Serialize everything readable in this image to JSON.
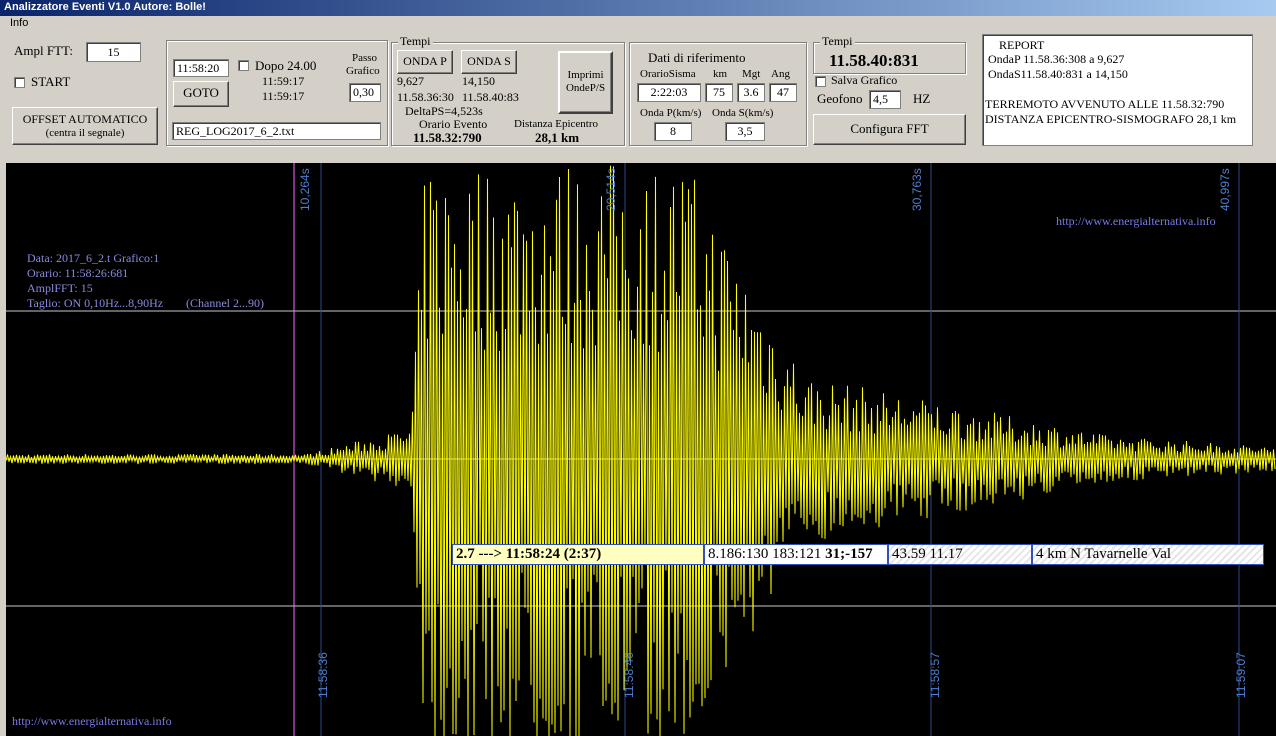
{
  "window": {
    "title": "Analizzatore Eventi V1.0  Autore: Bolle!"
  },
  "menu": {
    "info": "Info"
  },
  "controls": {
    "ampl_fft_label": "Ampl FTT:",
    "ampl_fft_value": "15",
    "start_label": "START",
    "offset_line1": "OFFSET AUTOMATICO",
    "offset_line2": "(centra il segnale)",
    "time_value": "11:58:20",
    "dopo_label": "Dopo 24.00",
    "time_a": "11:59:17",
    "time_b": "11:59:17",
    "goto_label": "GOTO",
    "passo_label1": "Passo",
    "passo_label2": "Grafico",
    "passo_value": "0,30",
    "file_value": "REG_LOG2017_6_2.txt"
  },
  "tempi": {
    "title": "Tempi",
    "onda_p_button": "ONDA P",
    "onda_s_button": "ONDA S",
    "p_value": "9,627",
    "s_value": "14,150",
    "p_time": "11.58.36:30",
    "s_time": "11.58.40:83",
    "delta": "DeltaPS=4,523s",
    "orario_label": "Orario Evento",
    "orario_value": "11.58.32:790",
    "distanza_label": "Distanza Epicentro",
    "distanza_value": "28,1 km",
    "imprimi_line1": "Imprimi",
    "imprimi_line2": "OndeP/S"
  },
  "riferimento": {
    "title": "Dati di riferimento",
    "col_orario": "OrarioSisma",
    "col_km": "km",
    "col_mgt": "Mgt",
    "col_ang": "Ang",
    "orario_value": "2:22:03",
    "km_value": "75",
    "mgt_value": "3.6",
    "ang_value": "47",
    "onda_p_label": "Onda P(km/s)",
    "onda_s_label": "Onda S(km/s)",
    "onda_p_value": "8",
    "onda_s_value": "3,5"
  },
  "tempi2": {
    "title": "Tempi",
    "value": "11.58.40:831",
    "salva_label": "Salva Grafico",
    "geofono_label": "Geofono",
    "geofono_value": "4,5",
    "hz_label": "HZ",
    "config_button": "Configura FFT"
  },
  "report": {
    "title": "REPORT",
    "line1": "OndaP 11.58.36:308 a 9,627",
    "line2": "OndaS11.58.40:831 a 14,150",
    "line3": "TERREMOTO AVVENUTO ALLE 11.58.32:790",
    "line4": "DISTANZA EPICENTRO-SISMOGRAFO 28,1 km"
  },
  "plot": {
    "top_ticks": [
      "10,264s",
      "20,514s",
      "30,763s",
      "40,997s"
    ],
    "bottom_ticks": [
      "11:58:36",
      "11:58:46",
      "11:58:57",
      "11:59:07"
    ],
    "url_top": "http://www.energialternativa.info",
    "url_bottom": "http://www.energialternativa.info",
    "info_line1": "Data: 2017_6_2.t Grafico:1",
    "info_line2": "Orario: 11:58:26:681",
    "info_line3": "AmplFFT: 15",
    "info_line4": "Taglio: ON 0,10Hz...8,90Hz",
    "info_channel": "(Channel 2...90)",
    "event_mag_prefix": "2.7 --->",
    "event_time": "11:58:24 (2:37)",
    "event_coords_a": "8.186:130 183:121",
    "event_coords_b": "31;-157",
    "event_latlon": "43.59 11.17",
    "event_place": "4 km N Tavarnelle Val",
    "colors": {
      "trace": "#ffff00",
      "background": "#000000",
      "marker": "#ff66ff",
      "grid": "#c8c8c8"
    }
  }
}
